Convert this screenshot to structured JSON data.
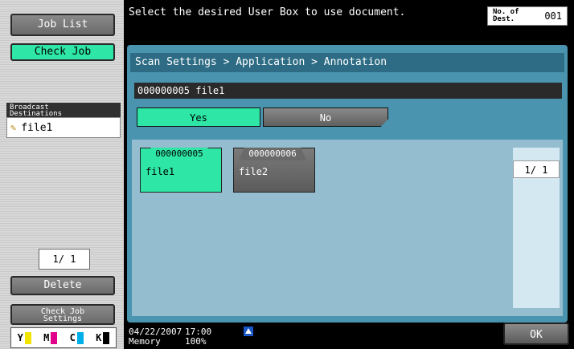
{
  "left": {
    "job_list": "Job List",
    "check_job": "Check Job",
    "broadcast_title_1": "Broadcast",
    "broadcast_title_2": "Destinations",
    "broadcast_item": "file1",
    "pager": "1/  1",
    "delete": "Delete",
    "check_job_settings_1": "Check Job",
    "check_job_settings_2": "Settings",
    "toner": [
      {
        "label": "Y",
        "color": "#f2e400"
      },
      {
        "label": "M",
        "color": "#e0008a"
      },
      {
        "label": "C",
        "color": "#00aee8"
      },
      {
        "label": "K",
        "color": "#000000"
      }
    ]
  },
  "header": {
    "message": "Select the desired User Box to use document.",
    "dest_label_1": "No. of",
    "dest_label_2": "Dest.",
    "dest_count": "001"
  },
  "main": {
    "breadcrumb": "Scan Settings > Application > Annotation",
    "document": "000000005  file1",
    "yes": "Yes",
    "no": "No",
    "boxes": [
      {
        "number": "000000005",
        "name": "file1",
        "selected": true
      },
      {
        "number": "000000006",
        "name": "file2",
        "selected": false
      }
    ],
    "pager": "1/  1"
  },
  "footer": {
    "date": "04/22/2007",
    "memory_label": "Memory",
    "time": "17:00",
    "memory_value": "100%",
    "ok": "OK"
  }
}
